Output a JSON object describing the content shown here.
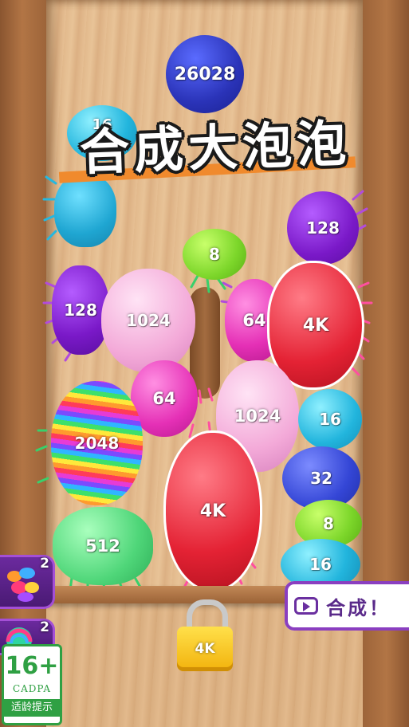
{
  "title": "合成大泡泡",
  "colors": {
    "purple": "#7a19c8",
    "pink": "#f3a9d8",
    "magenta": "#e530b6",
    "green": "#7cd62a",
    "red": "#e42234",
    "cyan": "#22b5dd",
    "blue": "#3446d6",
    "navy": "#2a33b8",
    "lightgreen": "#4fd679",
    "accent_orange": "#f08a2d"
  },
  "bubbles": [
    {
      "id": "bubble-26028-top",
      "label": "26028",
      "color": "navy"
    },
    {
      "id": "bubble-16-top",
      "label": "16",
      "color": "cyan"
    },
    {
      "id": "bubble-hidden-cyan",
      "label": "",
      "color": "cyan"
    },
    {
      "id": "bubble-128-right-top",
      "label": "128",
      "color": "purple"
    },
    {
      "id": "bubble-8-center",
      "label": "8",
      "color": "green"
    },
    {
      "id": "bubble-128-left",
      "label": "128",
      "color": "purple"
    },
    {
      "id": "bubble-1024-left",
      "label": "1024",
      "color": "pink"
    },
    {
      "id": "bubble-64-right",
      "label": "64",
      "color": "magenta"
    },
    {
      "id": "bubble-4k-right",
      "label": "4K",
      "color": "red"
    },
    {
      "id": "bubble-64-left",
      "label": "64",
      "color": "magenta"
    },
    {
      "id": "bubble-1024-right",
      "label": "1024",
      "color": "pink"
    },
    {
      "id": "bubble-16-right",
      "label": "16",
      "color": "cyan"
    },
    {
      "id": "bubble-2048-rainbow",
      "label": "2048",
      "color": "rainbow"
    },
    {
      "id": "bubble-32-right",
      "label": "32",
      "color": "blue"
    },
    {
      "id": "bubble-4k-center",
      "label": "4K",
      "color": "red"
    },
    {
      "id": "bubble-8-right",
      "label": "8",
      "color": "green"
    },
    {
      "id": "bubble-512-left",
      "label": "512",
      "color": "lightgreen"
    },
    {
      "id": "bubble-16-bottom-right",
      "label": "16",
      "color": "cyan"
    }
  ],
  "lock": {
    "label": "4K"
  },
  "powerups": [
    {
      "id": "powerup-candy",
      "count": "2",
      "icon": "candy-pile-icon"
    },
    {
      "id": "powerup-orb",
      "count": "2",
      "icon": "rainbow-orb-icon"
    }
  ],
  "promo": {
    "label": "合成！",
    "icon": "video-play-icon"
  },
  "rating": {
    "age": "16+",
    "org": "CADPA",
    "tip": "适龄提示"
  }
}
